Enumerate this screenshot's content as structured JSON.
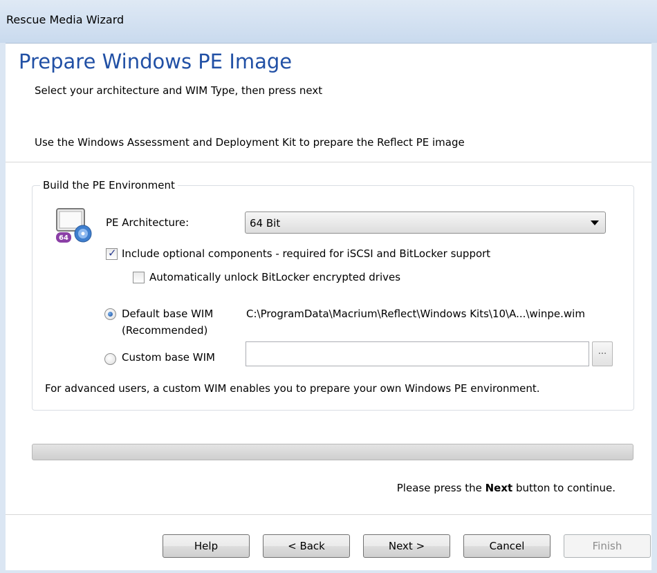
{
  "window": {
    "title": "Rescue Media Wizard"
  },
  "header": {
    "title": "Prepare Windows PE Image",
    "subtitle": "Select your architecture and WIM Type, then press next",
    "description": "Use the Windows Assessment and Deployment Kit to prepare the Reflect PE image"
  },
  "group": {
    "label": "Build the PE Environment",
    "icon_badge": "64",
    "arch_label": "PE Architecture:",
    "arch_value": "64 Bit",
    "optional_components_label": "Include optional components - required for iSCSI and BitLocker support",
    "optional_components_checked": true,
    "auto_unlock_label": "Automatically unlock BitLocker encrypted drives",
    "auto_unlock_checked": false,
    "default_wim_label": "Default base WIM",
    "default_wim_sub": "(Recommended)",
    "default_wim_path": "C:\\ProgramData\\Macrium\\Reflect\\Windows Kits\\10\\A...\\winpe.wim",
    "default_wim_selected": true,
    "custom_wim_label": "Custom base WIM",
    "custom_wim_value": "",
    "browse_label": "...",
    "advanced_note": "For advanced users, a custom WIM enables you to prepare your own Windows PE environment."
  },
  "progress": {
    "value": 0
  },
  "hint": {
    "prefix": "Please press the ",
    "bold": "Next",
    "suffix": " button to continue."
  },
  "buttons": {
    "help": "Help",
    "back": "< Back",
    "next": "Next >",
    "cancel": "Cancel",
    "finish": "Finish"
  }
}
